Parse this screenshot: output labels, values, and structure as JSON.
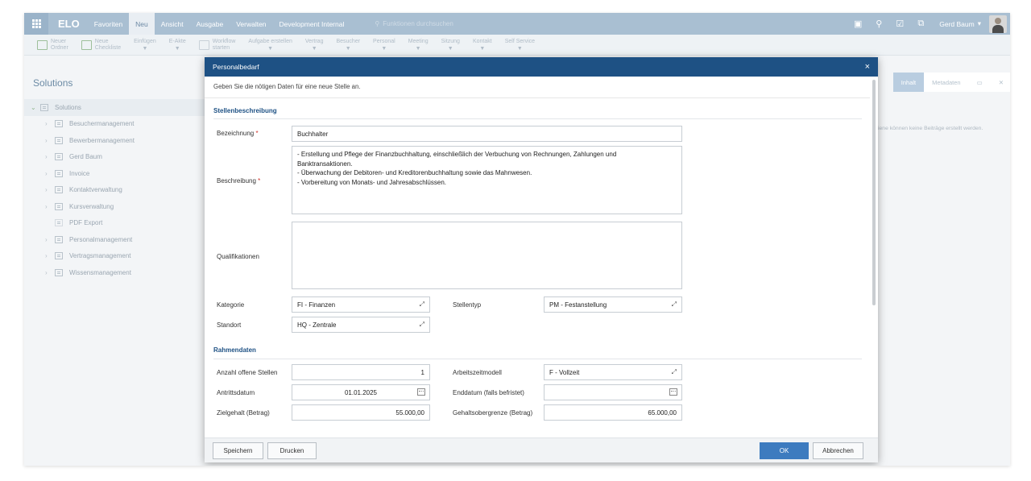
{
  "topbar": {
    "logo": "ELO",
    "tabs": [
      "Favoriten",
      "Neu",
      "Ansicht",
      "Ausgabe",
      "Verwalten",
      "Development Internal"
    ],
    "search_placeholder": "Funktionen durchsuchen",
    "user": "Gerd Baum"
  },
  "ribbon": {
    "new_folder": "Neuer\nOrdner",
    "new_checklist": "Neue\nCheckliste",
    "items": [
      "Einfügen",
      "E-Akte",
      "Workflow\nstarten",
      "Aufgabe erstellen",
      "Vertrag",
      "Besucher",
      "Personal",
      "Meeting",
      "Sitzung",
      "Kontakt",
      "Self Service"
    ]
  },
  "left": {
    "title": "Solutions",
    "root": "Solutions",
    "items": [
      "Besuchermanagement",
      "Bewerbermanagement",
      "Gerd Baum",
      "Invoice",
      "Kontaktverwaltung",
      "Kursverwaltung",
      "PDF Export",
      "Personalmanagement",
      "Vertragsmanagement",
      "Wissensmanagement"
    ]
  },
  "right": {
    "tab_inhalt": "Inhalt",
    "tab_metadaten": "Metadaten",
    "message": "iene können keine Beiträge erstellt werden."
  },
  "dialog": {
    "title": "Personalbedarf",
    "intro": "Geben Sie die nötigen Daten für eine neue Stelle an.",
    "section1": "Stellenbeschreibung",
    "section2": "Rahmendaten",
    "labels": {
      "bezeichnung": "Bezeichnung",
      "beschreibung": "Beschreibung",
      "qualifikationen": "Qualifikationen",
      "kategorie": "Kategorie",
      "stellentyp": "Stellentyp",
      "standort": "Standort",
      "anzahl": "Anzahl offene Stellen",
      "arbeitszeitmodell": "Arbeitszeitmodell",
      "antrittsdatum": "Antrittsdatum",
      "enddatum": "Enddatum (falls befristet)",
      "zielgehalt": "Zielgehalt (Betrag)",
      "gehaltsobergrenze": "Gehaltsobergrenze (Betrag)"
    },
    "required_mark": "*",
    "values": {
      "bezeichnung": "Buchhalter",
      "beschreibung": "- Erstellung und Pflege der Finanzbuchhaltung, einschließlich der Verbuchung von Rechnungen, Zahlungen und\nBanktransaktionen.\n- Überwachung der Debitoren- und Kreditorenbuchhaltung sowie das Mahnwesen.\n- Vorbereitung von Monats- und Jahresabschlüssen.",
      "qualifikationen": "",
      "kategorie": "FI - Finanzen",
      "stellentyp": "PM - Festanstellung",
      "standort": "HQ - Zentrale",
      "anzahl": "1",
      "arbeitszeitmodell": "F - Vollzeit",
      "antrittsdatum": "01.01.2025",
      "enddatum": "",
      "zielgehalt": "55.000,00",
      "gehaltsobergrenze": "65.000,00"
    },
    "buttons": {
      "speichern": "Speichern",
      "drucken": "Drucken",
      "ok": "OK",
      "abbrechen": "Abbrechen"
    }
  },
  "colors": {
    "dialog_header": "#1e5184",
    "topbar": "#a9bfd2",
    "primary_button": "#3d7bbf",
    "required": "#d0342c"
  }
}
